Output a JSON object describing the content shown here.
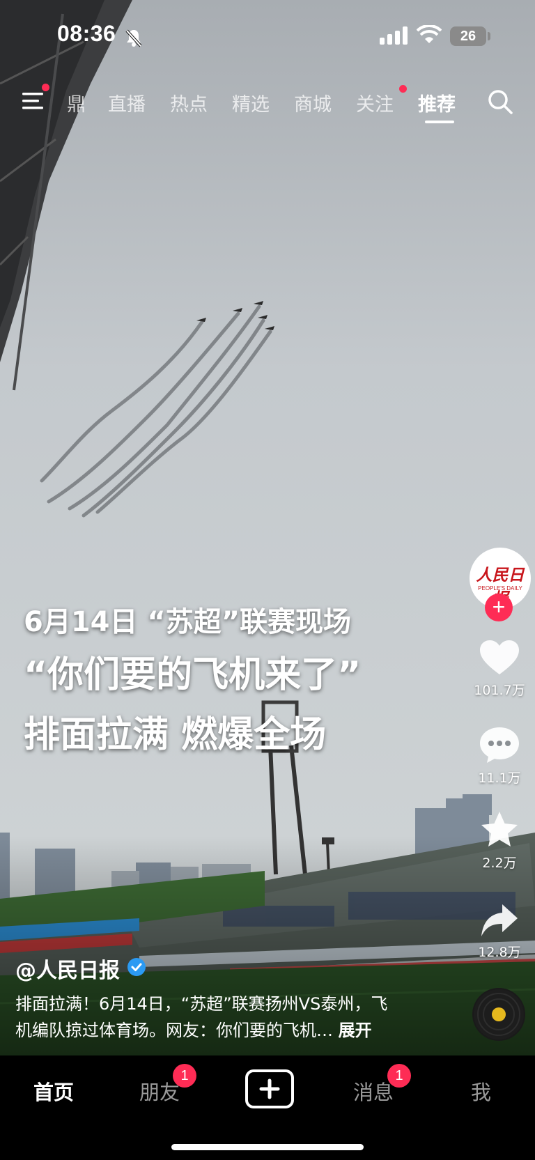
{
  "status_bar": {
    "time": "08:36",
    "battery": "26"
  },
  "top_nav": {
    "tabs": [
      "鼎",
      "直播",
      "热点",
      "精选",
      "商城",
      "关注",
      "推荐"
    ],
    "active_tab": "推荐"
  },
  "video": {
    "caption_lines": [
      "6月14日 “苏超”联赛现场",
      "“你们要的飞机来了”",
      "排面拉满 燃爆全场"
    ]
  },
  "sidebar": {
    "avatar_text_cn": "人民日报",
    "avatar_text_en": "PEOPLE'S DAILY",
    "follow": "+",
    "likes": "101.7万",
    "comments": "11.1万",
    "favorites": "2.2万",
    "shares": "12.8万"
  },
  "post": {
    "author": "@人民日报",
    "description_line1": "排面拉满！6月14日，“苏超”联赛扬州VS泰州，飞",
    "description_line2": "机编队掠过体育场。网友：你们要的飞机…",
    "expand": "展开"
  },
  "bottom_nav": {
    "home": "首页",
    "friends": "朋友",
    "friends_badge": "1",
    "create": "+",
    "messages": "消息",
    "messages_badge": "1",
    "me": "我"
  },
  "colors": {
    "accent": "#fe2c55",
    "sky": "#c9cfd3",
    "grass": "#2f5a2a"
  }
}
